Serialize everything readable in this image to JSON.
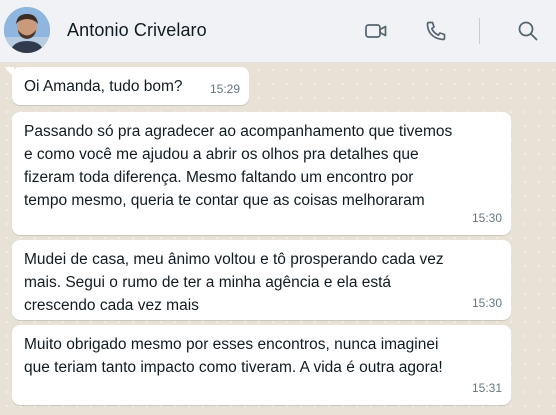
{
  "header": {
    "contact_name": "Antonio Crivelaro",
    "avatar_icon": "contact-photo",
    "actions": [
      "video-call-icon",
      "voice-call-icon",
      "search-icon"
    ]
  },
  "messages": [
    {
      "text": "Oi Amanda, tudo bom?",
      "time": "15:29"
    },
    {
      "text": "Passando só pra agradecer ao acompanhamento que tivemos\ne como você me ajudou a abrir os olhos pra detalhes que\nfizeram toda diferença. Mesmo faltando um encontro por\ntempo mesmo, queria te contar que as coisas melhoraram",
      "time": "15:30"
    },
    {
      "text": "Mudei de casa, meu ânimo voltou e tô prosperando cada vez\nmais. Segui o rumo de ter a minha agência e ela está\ncrescendo cada vez mais",
      "time": "15:30"
    },
    {
      "text": "Muito obrigado mesmo por esses encontros, nunca imaginei\nque teriam tanto impacto como tiveram. A vida é outra agora!",
      "time": "15:31"
    }
  ],
  "colors": {
    "header_bg": "#f0f2f5",
    "chat_bg": "#efeae2",
    "bubble_bg": "#ffffff",
    "timestamp": "#667781",
    "text": "#111b21"
  }
}
